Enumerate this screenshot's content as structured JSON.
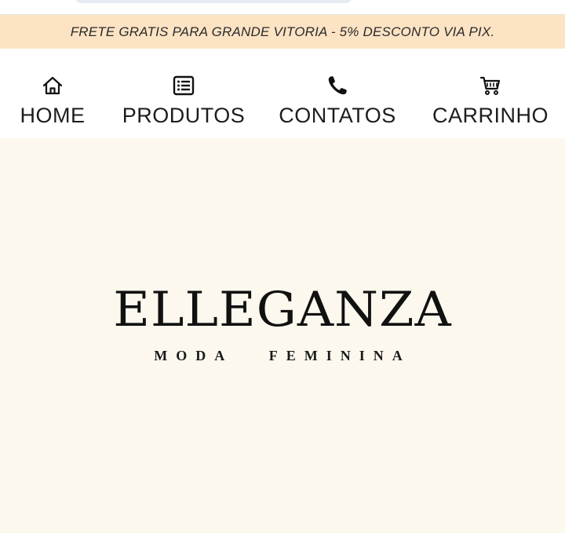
{
  "promo": {
    "text": "FRETE GRATIS PARA GRANDE VITORIA - 5% DESCONTO VIA PIX."
  },
  "nav": {
    "items": [
      {
        "label": "HOME",
        "icon": "home-icon"
      },
      {
        "label": "PRODUTOS",
        "icon": "list-icon"
      },
      {
        "label": "CONTATOS",
        "icon": "phone-icon"
      },
      {
        "label": "CARRINHO",
        "icon": "cart-icon"
      }
    ]
  },
  "brand": {
    "name": "ELLEGANZA",
    "tagline": "MODA   FEMININA"
  },
  "colors": {
    "promo_background": "#fce3c4",
    "hero_background": "#fdf8ee",
    "text": "#1d1d1d"
  }
}
